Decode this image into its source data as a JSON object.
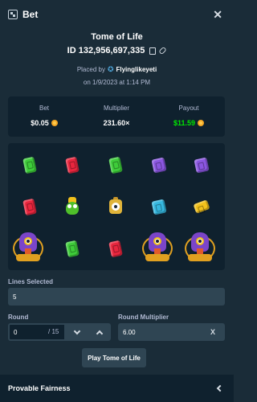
{
  "header": {
    "title": "Bet"
  },
  "game": {
    "title": "Tome of Life",
    "bet_id": "ID 132,956,697,335",
    "placed_by_prefix": "Placed by",
    "username": "Flyinglikeyeti",
    "date": "on 1/9/2023 at 1:14 PM"
  },
  "stats": {
    "bet_label": "Bet",
    "bet_value": "$0.05",
    "multiplier_label": "Multiplier",
    "multiplier_value": "231.60×",
    "payout_label": "Payout",
    "payout_value": "$11.59"
  },
  "grid": {
    "columns": [
      [
        "green-gem",
        "red-gem",
        "purple-idol"
      ],
      [
        "red-gem",
        "green-creature",
        "green-gem"
      ],
      [
        "green-gem",
        "eye-lantern",
        "red-gem"
      ],
      [
        "purple-gem",
        "blue-gem",
        "purple-idol"
      ],
      [
        "purple-gem",
        "yellow-gem",
        "purple-idol"
      ]
    ]
  },
  "form": {
    "lines_label": "Lines Selected",
    "lines_value": "5",
    "round_label": "Round",
    "round_value": "0",
    "round_max": "/ 15",
    "round_multiplier_label": "Round Multiplier",
    "round_multiplier_value": "6.00",
    "multiplier_suffix": "X",
    "play_label": "Play Tome of Life"
  },
  "footer": {
    "title": "Provable Fairness"
  },
  "colors": {
    "background": "#1a2c38",
    "panel": "#0f212e",
    "input": "#2f4553",
    "payout_green": "#00e701",
    "muted_text": "#b1bad3"
  }
}
